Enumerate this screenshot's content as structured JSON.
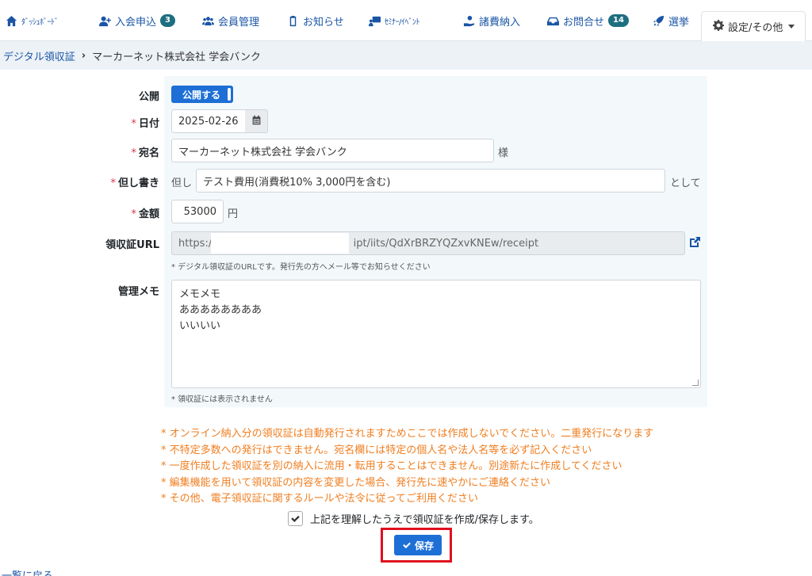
{
  "nav": {
    "dashboard": "ﾀﾞｯｼｭﾎﾞｰﾄﾞ",
    "application": "入会申込",
    "application_badge": "3",
    "members": "会員管理",
    "notices": "お知らせ",
    "seminar": "ｾﾐﾅｰ/ｲﾍﾞﾝﾄ",
    "fees": "諸費納入",
    "inquiry": "お問合せ",
    "inquiry_badge": "14",
    "election": "選挙",
    "settings": "設定/その他"
  },
  "breadcrumb": {
    "parent": "デジタル領収証",
    "current": "マーカーネット株式会社 学会バンク"
  },
  "form": {
    "public_label": "公開",
    "public_toggle": "公開する",
    "date_label": "日付",
    "date_value": "2025-02-26",
    "addressee_label": "宛名",
    "addressee_value": "マーカーネット株式会社 学会バンク",
    "addressee_suffix": "様",
    "note_label": "但し書き",
    "note_prefix": "但し",
    "note_value": "テスト費用(消費税10% 3,000円を含む)",
    "note_suffix": "として",
    "amount_label": "金額",
    "amount_value": "53000",
    "amount_suffix": "円",
    "url_label": "領収証URL",
    "url_prefix": "https://",
    "url_tail": "ipt/iits/QdXrBRZYQZxvKNEw/receipt",
    "url_help": "* デジタル領収証のURLです。発行先の方へメール等でお知らせください",
    "memo_label": "管理メモ",
    "memo_lines": [
      "メモメモ",
      "ああああああああ",
      "いいいい"
    ],
    "memo_help": "* 領収証には表示されません",
    "required_mark": "*"
  },
  "notes": [
    "* オンライン納入分の領収証は自動発行されますためここでは作成しないでください。二重発行になります",
    "* 不特定多数への発行はできません。宛名欄には特定の個人名や法人名等を必ず記入ください",
    "* 一度作成した領収証を別の納入に流用・転用することはできません。別途新たに作成してください",
    "* 編集機能を用いて領収証の内容を変更した場合、発行先に速やかにご連絡ください",
    "* その他、電子領収証に関するルールや法令に従ってご利用ください"
  ],
  "agree_label": "上記を理解したうえで領収証を作成/保存します。",
  "save_label": "保存",
  "back_label": "一覧に戻る",
  "colors": {
    "link": "#1a55a5",
    "primary": "#1d6fd6",
    "badge": "#1d6f80",
    "warning_text": "#f07e20",
    "highlight": "#e0101e"
  }
}
